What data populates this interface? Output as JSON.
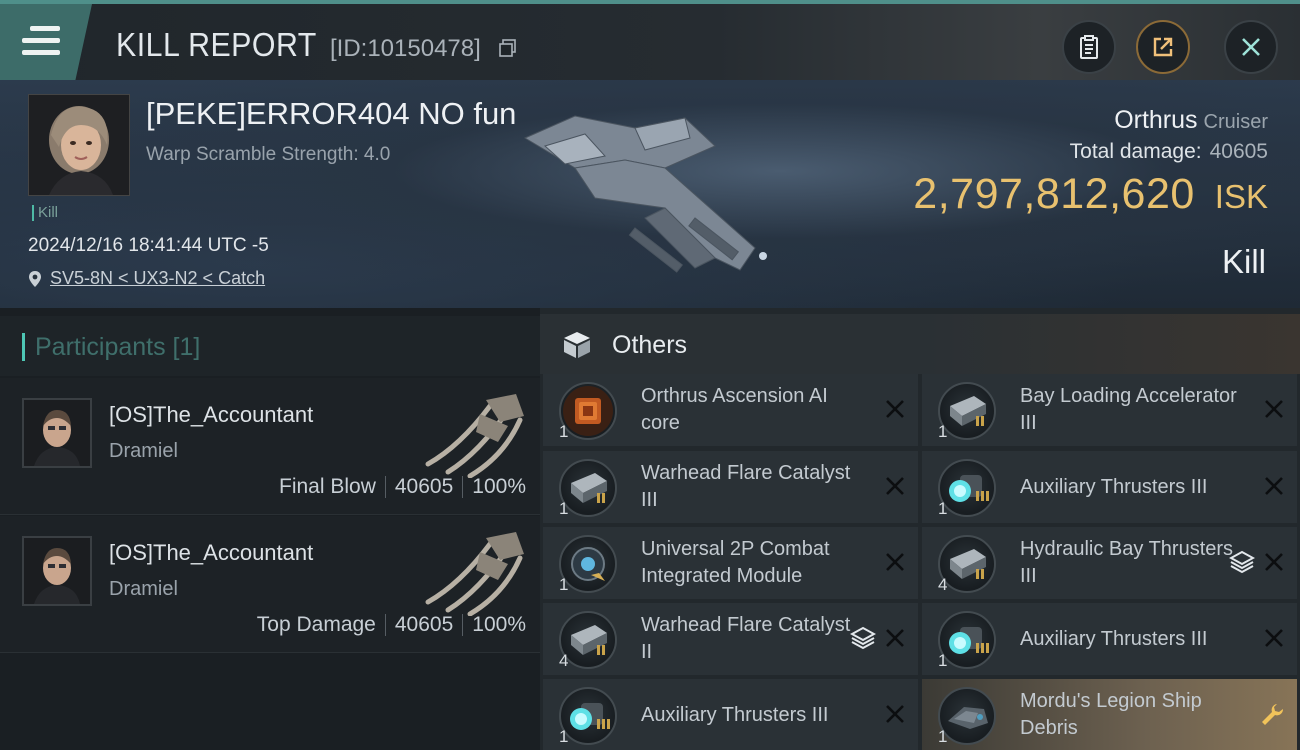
{
  "header": {
    "title": "KILL REPORT",
    "report_id": "[ID:10150478]"
  },
  "victim": {
    "name": "[PEKE]ERROR404 NO fun",
    "warp_scramble": "Warp Scramble Strength: 4.0",
    "tag": "Kill",
    "datetime": "2024/12/16 18:41:44 UTC -5",
    "location": "SV5-8N < UX3-N2 < Catch"
  },
  "ship": {
    "name": "Orthrus",
    "class": "Cruiser",
    "total_damage_label": "Total damage:",
    "total_damage": "40605",
    "isk_value": "2,797,812,620",
    "isk_unit": "ISK",
    "result": "Kill"
  },
  "participants": {
    "title": "Participants [1]",
    "rows": [
      {
        "name": "[OS]The_Accountant",
        "ship": "Dramiel",
        "role": "Final Blow",
        "damage": "40605",
        "percent": "100%"
      },
      {
        "name": "[OS]The_Accountant",
        "ship": "Dramiel",
        "role": "Top Damage",
        "damage": "40605",
        "percent": "100%"
      }
    ]
  },
  "others": {
    "title": "Others",
    "items": [
      {
        "name": "Orthrus Ascension AI core",
        "qty": "1",
        "icon": "ai-core-icon"
      },
      {
        "name": "Bay Loading Accelerator III",
        "qty": "1",
        "icon": "module-icon"
      },
      {
        "name": "Warhead Flare Catalyst III",
        "qty": "1",
        "icon": "module-icon"
      },
      {
        "name": "Auxiliary Thrusters III",
        "qty": "1",
        "icon": "thruster-icon"
      },
      {
        "name": "Universal 2P Combat Integrated Module",
        "qty": "1",
        "icon": "combat-module-icon"
      },
      {
        "name": "Hydraulic Bay Thrusters III",
        "qty": "4",
        "icon": "module-icon"
      },
      {
        "name": "Warhead Flare Catalyst II",
        "qty": "4",
        "icon": "module-icon"
      },
      {
        "name": "Auxiliary Thrusters III",
        "qty": "1",
        "icon": "thruster-icon"
      },
      {
        "name": "Auxiliary Thrusters III",
        "qty": "1",
        "icon": "thruster-icon"
      },
      {
        "name": "Mordu's Legion Ship Debris",
        "qty": "1",
        "icon": "debris-icon"
      }
    ]
  },
  "colors": {
    "accent_teal": "#4ec7b5",
    "isk_gold": "#e8c16f"
  }
}
